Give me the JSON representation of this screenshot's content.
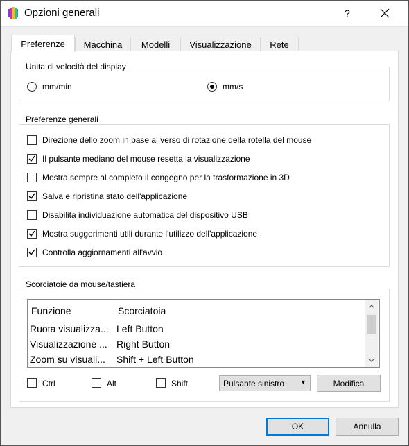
{
  "window": {
    "title": "Opzioni generali",
    "help_label": "?",
    "close_label": "✕"
  },
  "tabs": [
    {
      "label": "Preferenze",
      "active": true
    },
    {
      "label": "Macchina",
      "active": false
    },
    {
      "label": "Modelli",
      "active": false
    },
    {
      "label": "Visualizzazione",
      "active": false
    },
    {
      "label": "Rete",
      "active": false
    }
  ],
  "speed_unit": {
    "title": "Unita di velocità del display",
    "options": [
      {
        "label": "mm/min",
        "selected": false
      },
      {
        "label": "mm/s",
        "selected": true
      }
    ]
  },
  "general": {
    "title": "Preferenze generali",
    "items": [
      {
        "label": "Direzione dello zoom in base al verso di rotazione della rotella del mouse",
        "checked": false
      },
      {
        "label": "Il pulsante mediano del mouse resetta la visualizzazione",
        "checked": true
      },
      {
        "label": "Mostra sempre al completo il congegno per la trasformazione in 3D",
        "checked": false
      },
      {
        "label": "Salva e ripristina stato dell'applicazione",
        "checked": true
      },
      {
        "label": "Disabilita individuazione automatica del dispositivo USB",
        "checked": false
      },
      {
        "label": "Mostra suggerimenti utili durante l'utilizzo dell'applicazione",
        "checked": true
      },
      {
        "label": "Controlla aggiornamenti all'avvio",
        "checked": true
      }
    ]
  },
  "shortcuts": {
    "title": "Scorciatoie da mouse/tastiera",
    "columns": [
      "Funzione",
      "Scorciatoia"
    ],
    "rows": [
      [
        "Ruota visualizza...",
        "Left Button"
      ],
      [
        "Visualizzazione ...",
        "Right Button"
      ],
      [
        "Zoom su visuali...",
        "Shift + Left Button"
      ]
    ],
    "modifiers": [
      {
        "label": "Ctrl",
        "checked": false
      },
      {
        "label": "Alt",
        "checked": false
      },
      {
        "label": "Shift",
        "checked": false
      }
    ],
    "mouse_button_selected": "Pulsante sinistro",
    "edit_label": "Modifica"
  },
  "footer": {
    "ok_label": "OK",
    "cancel_label": "Annulla"
  },
  "colors": {
    "accent": "#0078d7",
    "background": "#f0f0f0"
  }
}
